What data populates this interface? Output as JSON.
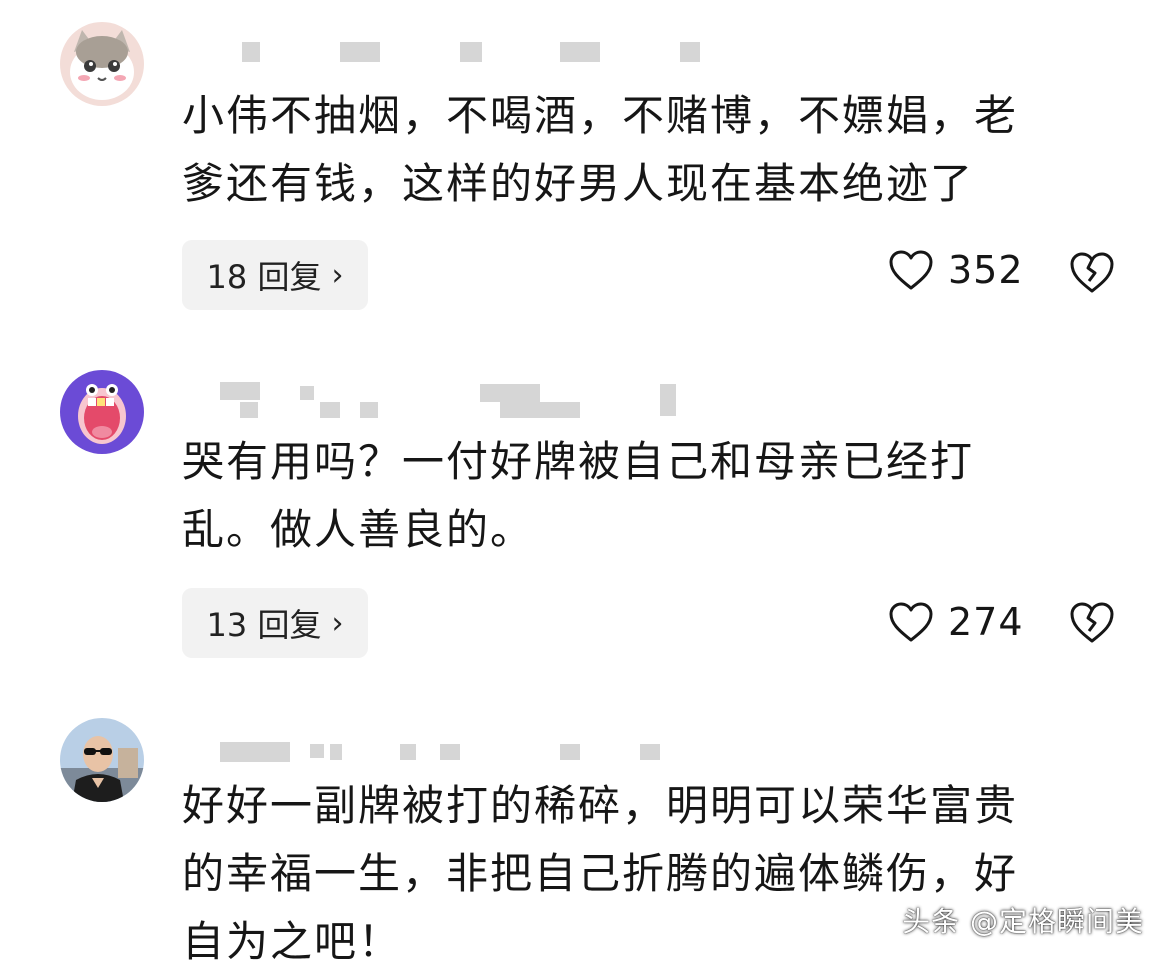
{
  "comments": [
    {
      "avatar_icon": "cat-avatar-icon",
      "text_line1": "小伟不抽烟，不喝酒，不赌博，不嫖娼，老",
      "text_line2": "爹还有钱，这样的好男人现在基本绝迹了",
      "reply_label": "18 回复",
      "likes": "352"
    },
    {
      "avatar_icon": "cartoon-mouth-avatar-icon",
      "text_line1": "哭有用吗？一付好牌被自己和母亲已经打",
      "text_line2": "乱。做人善良的。",
      "reply_label": "13 回复",
      "likes": "274"
    },
    {
      "avatar_icon": "man-sunglasses-avatar-icon",
      "text_line1": "好好一副牌被打的稀碎，明明可以荣华富贵",
      "text_line2": "的幸福一生，非把自己折腾的遍体鳞伤，好",
      "text_line3": "自为之吧！"
    }
  ],
  "watermark": "头条 @定格瞬间美",
  "colors": {
    "text": "#161616",
    "reply_bg": "#f2f2f2",
    "blur": "#cfcfcf"
  }
}
